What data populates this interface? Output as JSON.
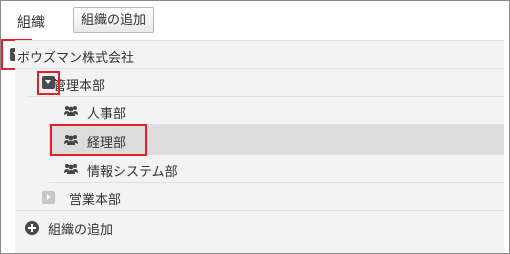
{
  "header": {
    "title": "組織",
    "add_button_label": "組織の追加"
  },
  "tree": {
    "root": {
      "label": "ボウズマン株式会社",
      "expanded": true
    },
    "management": {
      "label": "管理本部",
      "expanded": true
    },
    "hr": {
      "label": "人事部"
    },
    "accounting": {
      "label": "経理部",
      "selected": true
    },
    "it": {
      "label": "情報システム部"
    },
    "sales": {
      "label": "営業本部",
      "expanded": false
    }
  },
  "footer": {
    "add_label": "組織の追加"
  },
  "colors": {
    "highlight": "#e0202a",
    "selected_row": "#dcdcdc",
    "panel_bg": "#f3f3f3"
  }
}
